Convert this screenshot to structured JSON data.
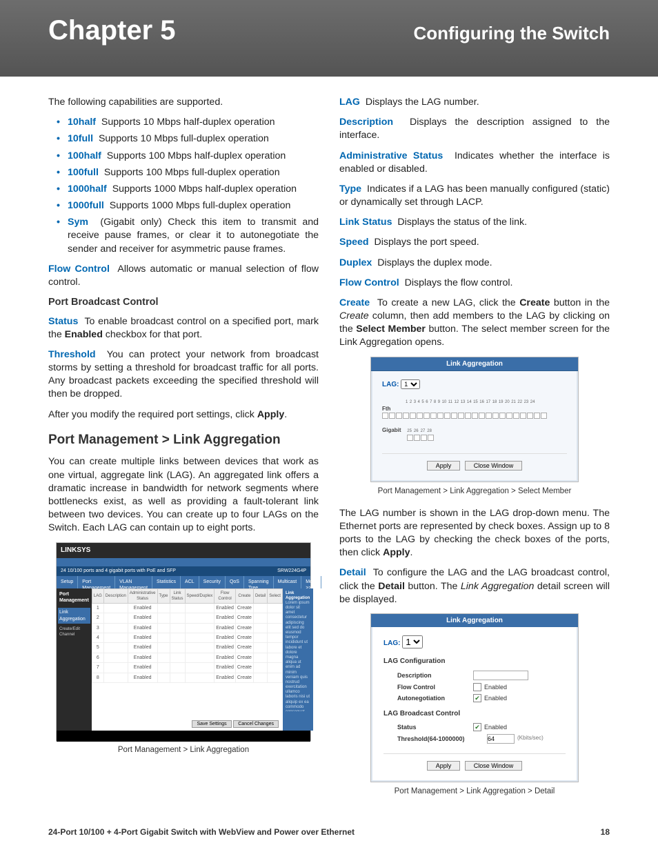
{
  "header": {
    "chapter": "Chapter 5",
    "title": "Configuring the Switch"
  },
  "left": {
    "intro": "The following capabilities are supported.",
    "caps": [
      {
        "term": "10half",
        "desc": "Supports 10 Mbps half-duplex operation"
      },
      {
        "term": "10full",
        "desc": "Supports 10 Mbps full-duplex operation"
      },
      {
        "term": "100half",
        "desc": "Supports 100 Mbps half-duplex operation"
      },
      {
        "term": "100full",
        "desc": "Supports 100 Mbps full-duplex operation"
      },
      {
        "term": "1000half",
        "desc": "Supports 1000 Mbps half-duplex operation"
      },
      {
        "term": "1000full",
        "desc": "Supports 1000 Mbps full-duplex operation"
      },
      {
        "term": "Sym",
        "desc": "(Gigabit only)  Check this item to transmit and receive pause frames, or clear it to autonegotiate the sender and receiver for asymmetric pause frames."
      }
    ],
    "flowcontrol": {
      "term": "Flow Control",
      "text": "Allows automatic or manual selection of flow control."
    },
    "pbc_head": "Port Broadcast Control",
    "status": {
      "term": "Status",
      "text1": "To enable broadcast control on a specified port, mark the ",
      "bold": "Enabled",
      "text2": " checkbox for that port."
    },
    "threshold": {
      "term": "Threshold",
      "text": "You can protect your network from broadcast storms by setting a threshold for broadcast traffic for all ports. Any broadcast packets exceeding the specified threshold will then be dropped."
    },
    "apply_line": {
      "pre": "After you modify the required port settings, click ",
      "bold": "Apply",
      "post": "."
    },
    "section": "Port Management > Link Aggregation",
    "section_text": "You can create multiple links between devices that work as one virtual, aggregate link (LAG). An aggregated link offers a dramatic increase in bandwidth for network segments where bottlenecks exist, as well as providing a fault-tolerant link between two devices. You can create up to four LAGs on the Switch. Each LAG can contain up to eight ports.",
    "fig1cap": "Port Management > Link Aggregation"
  },
  "right": {
    "defs": [
      {
        "term": "LAG",
        "text": "Displays the LAG number."
      },
      {
        "term": "Description",
        "text": "Displays the description assigned to the interface."
      },
      {
        "term": "Administrative Status",
        "text": "Indicates whether the interface is enabled or disabled."
      },
      {
        "term": "Type",
        "text": "Indicates if a LAG has been manually configured (static) or dynamically set through LACP."
      },
      {
        "term": "Link Status",
        "text": "Displays the status  of the link."
      },
      {
        "term": "Speed",
        "text": "Displays the port speed."
      },
      {
        "term": "Duplex",
        "text": "Displays the duplex mode."
      },
      {
        "term": "Flow Control",
        "text": "Displays the flow control."
      }
    ],
    "create": {
      "term": "Create",
      "t1": "To create a new LAG, click the ",
      "b1": "Create",
      "t2": " button in the ",
      "i1": "Create",
      "t3": " column, then add members to the LAG by clicking on the ",
      "b2": "Select Member",
      "t4": " button. The select member screen for the Link Aggregation opens."
    },
    "fig2cap": "Port Management > Link Aggregation > Select Member",
    "lagnum_para": {
      "t1": "The LAG number is shown in the LAG drop-down menu. The Ethernet ports are represented by check boxes. Assign up to 8 ports to the LAG by checking the check boxes of the ports, then click ",
      "b": "Apply",
      "t2": "."
    },
    "detail": {
      "term": "Detail",
      "t1": "To configure the LAG and the LAG broadcast control, click the ",
      "b": "Detail",
      "t2": " button. The ",
      "i": "Link Aggregation",
      "t3": " detail screen will be displayed."
    },
    "fig3cap": "Port Management > Link Aggregation > Detail"
  },
  "mock1": {
    "brand": "LINKSYS",
    "sidetitle": "Port Management",
    "sideitem": "Link Aggregation",
    "sidesub": "Create/Edit Channel",
    "topline_left": "24 10/100 ports and 4 gigabit ports with PoE and SFP",
    "topline_right": "SRW224G4P",
    "tabs": [
      "Setup",
      "Port Management",
      "VLAN Management",
      "Statistics",
      "ACL",
      "Security",
      "QoS",
      "Spanning Tree",
      "Multicast",
      "More >>"
    ],
    "thead": [
      "LAG",
      "Description",
      "Administrative Status",
      "Type",
      "Link Status",
      "Speed/Duplex",
      "Flow Control",
      "Create",
      "Detail",
      "Select"
    ],
    "rows": [
      "1",
      "2",
      "3",
      "4",
      "5",
      "6",
      "7",
      "8"
    ],
    "cell_enabled": "Enabled",
    "cell_create": "Create",
    "btn_save": "Save Settings",
    "btn_cancel": "Cancel Changes",
    "help_title": "Link Aggregation"
  },
  "mock2": {
    "title": "Link Aggregation",
    "lag_label": "LAG:",
    "lag_value": "1",
    "row1_label": "Fth",
    "port_nums": [
      "1",
      "2",
      "3",
      "4",
      "5",
      "6",
      "7",
      "8",
      "9",
      "10",
      "11",
      "12",
      "13",
      "14",
      "15",
      "16",
      "17",
      "18",
      "19",
      "20",
      "21",
      "22",
      "23",
      "24"
    ],
    "row2_label": "Gigabit",
    "gig_nums": [
      "25",
      "26",
      "27",
      "28"
    ],
    "btn_apply": "Apply",
    "btn_close": "Close Window"
  },
  "mock3": {
    "title": "Link Aggregation",
    "lag_label": "LAG:",
    "lag_value": "1",
    "grp1": "LAG Configuration",
    "f_desc": "Description",
    "f_flow": "Flow Control",
    "f_auto": "Autonegotiation",
    "enabled": "Enabled",
    "grp2": "LAG Broadcast Control",
    "f_status": "Status",
    "f_thresh": "Threshold(64-1000000)",
    "thresh_val": "64",
    "thresh_unit": "(Kbits/sec)",
    "btn_apply": "Apply",
    "btn_close": "Close Window"
  },
  "footer": {
    "prod": "24-Port 10/100 + 4-Port Gigabit Switch with WebView and Power over Ethernet",
    "page": "18"
  }
}
